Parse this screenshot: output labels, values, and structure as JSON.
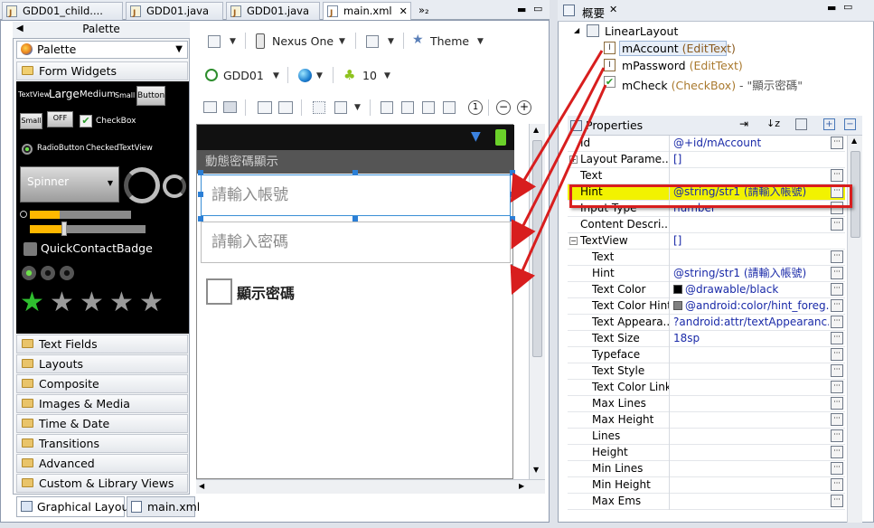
{
  "tabs": [
    {
      "label": "GDD01_child...."
    },
    {
      "label": "GDD01.java"
    },
    {
      "label": "GDD01.java"
    },
    {
      "label": "main.xml",
      "active": true
    },
    {
      "label": "»₂"
    }
  ],
  "palette": {
    "title": "Palette",
    "selector": "Palette",
    "current": "Form Widgets",
    "widgets": {
      "textview": "TextView",
      "large": "Large",
      "medium": "Medium",
      "small": "Small",
      "button": "Button",
      "small_btn": "Small",
      "off_btn": "OFF",
      "checkbox": "CheckBox",
      "radio": "RadioButton",
      "checked_tv": "CheckedTextView",
      "spinner": "Spinner",
      "quick_badge": "QuickContactBadge"
    },
    "categories": [
      "Text Fields",
      "Layouts",
      "Composite",
      "Images & Media",
      "Time & Date",
      "Transitions",
      "Advanced",
      "Custom & Library Views"
    ]
  },
  "toolbar": {
    "device": "Nexus One",
    "theme": "Theme",
    "activity": "GDD01",
    "api": "10"
  },
  "device": {
    "title": "動態密碼顯示",
    "account_hint": "請輸入帳號",
    "password_hint": "請輸入密碼",
    "checkbox_label": "顯示密碼"
  },
  "bottom_tabs": [
    "Graphical Layout",
    "main.xml"
  ],
  "outline": {
    "title": "概要",
    "root": "LinearLayout",
    "items": [
      {
        "id": "mAccount",
        "type": "(EditText)"
      },
      {
        "id": "mPassword",
        "type": "(EditText)"
      },
      {
        "id": "mCheck",
        "type": "(CheckBox)",
        "extra": " - \"顯示密碼\""
      }
    ]
  },
  "properties": {
    "title": "Properties",
    "rows": [
      {
        "name": "Id",
        "value": "@+id/mAccount",
        "btn": true,
        "lvl": 1
      },
      {
        "name": "Layout Parame...",
        "value": "[]",
        "tw": "+",
        "lvl": 1
      },
      {
        "name": "Text",
        "value": "",
        "btn": true,
        "lvl": 1
      },
      {
        "name": "Hint",
        "value": "@string/str1 (請輸入帳號)",
        "btn": true,
        "lvl": 1,
        "hl": true
      },
      {
        "name": "Input Type",
        "value": "number",
        "btn": true,
        "lvl": 1
      },
      {
        "name": "Content Descri...",
        "value": "",
        "btn": true,
        "lvl": 1
      },
      {
        "name": "TextView",
        "value": "[]",
        "tw": "−",
        "lvl": 1
      },
      {
        "name": "Text",
        "value": "",
        "btn": true,
        "lvl": 2
      },
      {
        "name": "Hint",
        "value": "@string/str1 (請輸入帳號)",
        "btn": true,
        "lvl": 2
      },
      {
        "name": "Text Color",
        "value": "@drawable/black",
        "btn": true,
        "lvl": 2,
        "sw": "#000000"
      },
      {
        "name": "Text Color Hint",
        "value": "@android:color/hint_foreg...",
        "btn": true,
        "lvl": 2,
        "sw": "#808080"
      },
      {
        "name": "Text Appeara...",
        "value": "?android:attr/textAppearanc...",
        "btn": true,
        "lvl": 2
      },
      {
        "name": "Text Size",
        "value": "18sp",
        "btn": true,
        "lvl": 2
      },
      {
        "name": "Typeface",
        "value": "",
        "btn": true,
        "lvl": 2
      },
      {
        "name": "Text Style",
        "value": "",
        "btn": true,
        "lvl": 2
      },
      {
        "name": "Text Color Link",
        "value": "",
        "btn": true,
        "lvl": 2
      },
      {
        "name": "Max Lines",
        "value": "",
        "btn": true,
        "lvl": 2
      },
      {
        "name": "Max Height",
        "value": "",
        "btn": true,
        "lvl": 2
      },
      {
        "name": "Lines",
        "value": "",
        "btn": true,
        "lvl": 2
      },
      {
        "name": "Height",
        "value": "",
        "btn": true,
        "lvl": 2
      },
      {
        "name": "Min Lines",
        "value": "",
        "btn": true,
        "lvl": 2
      },
      {
        "name": "Min Height",
        "value": "",
        "btn": true,
        "lvl": 2
      },
      {
        "name": "Max Ems",
        "value": "",
        "btn": true,
        "lvl": 2
      }
    ]
  },
  "colors": {
    "highlight": "#f2f200",
    "highlight_border": "#d81e1e",
    "arrow": "#d81e1e",
    "accent_blue": "#1a2aa8"
  }
}
